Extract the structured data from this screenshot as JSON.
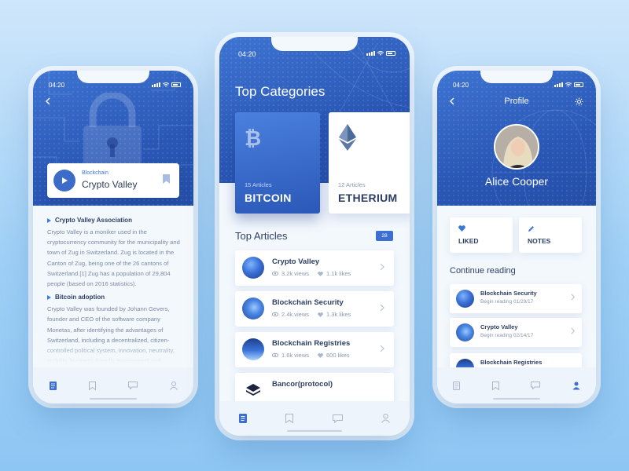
{
  "colors": {
    "accent": "#3c6fd0",
    "hero": "#2a57b6",
    "text_dark": "#2d3f63",
    "text_muted": "#8a97ad"
  },
  "left": {
    "status_time": "04:20",
    "audio_card": {
      "tag": "Blockchain",
      "title": "Crypto Valley"
    },
    "sections": [
      {
        "heading": "Crypto Valley Association",
        "body": "Crypto Valley is a moniker used in the cryptocurrency community for the municipality and town of Zug in Switzerland. Zug is located in the Canton of Zug, being one of the 26 cantons of Switzerland.[1] Zug has a population of 29,804 people (based on 2016 statistics)."
      },
      {
        "heading": "Bitcoin adoption",
        "body": "Crypto Valley was founded by Johann Gevers, founder and CEO of the software company Monetas, after identifying the advantages of Switzerland, including a decentralized, citizen-controlled political system, innovation, neutrality, stability, business-friendly environment and"
      }
    ]
  },
  "center": {
    "status_time": "04:20",
    "categories_title": "Top Categories",
    "categories": [
      {
        "count": "15 Articles",
        "name": "BITCOIN",
        "icon": "bitcoin-icon"
      },
      {
        "count": "12 Articles",
        "name": "ETHERIUM",
        "icon": "ethereum-icon"
      }
    ],
    "articles_title": "Top Articles",
    "articles_badge": "28",
    "articles": [
      {
        "title": "Crypto Valley",
        "views": "3.2k views",
        "likes": "1.1k likes"
      },
      {
        "title": "Blockchain Security",
        "views": "2.4k views",
        "likes": "1.3k likes"
      },
      {
        "title": "Blockchain Registries",
        "views": "1.6k views",
        "likes": "600 likes"
      },
      {
        "title": "Bancor(protocol)",
        "views": "",
        "likes": ""
      }
    ]
  },
  "right": {
    "status_time": "04:20",
    "title": "Profile",
    "name": "Alice Cooper",
    "stats": [
      {
        "label": "LIKED",
        "icon": "heart-icon"
      },
      {
        "label": "NOTES",
        "icon": "pencil-icon"
      }
    ],
    "continue_title": "Continue reading",
    "reading": [
      {
        "title": "Blockchain Security",
        "sub": "Begin reading 01/29/17"
      },
      {
        "title": "Crypto Valley",
        "sub": "Begin reading 02/14/17"
      },
      {
        "title": "Blockchain Registries",
        "sub": ""
      }
    ]
  }
}
